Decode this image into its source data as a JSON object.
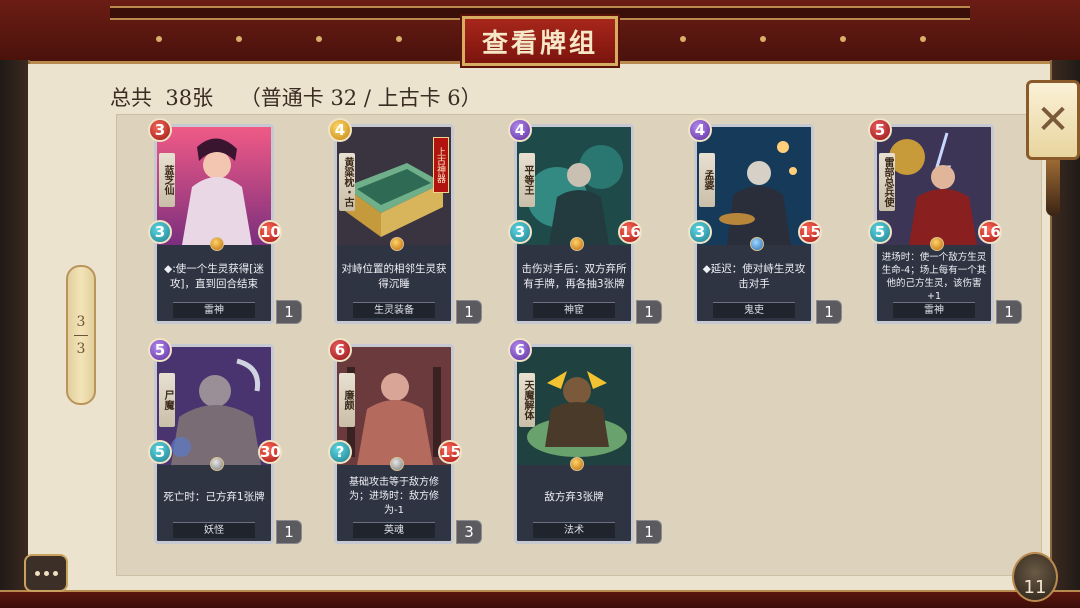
{
  "window": {
    "title": "查看牌组"
  },
  "summary": {
    "text": "总共  38张    （普通卡 32 / 上古卡 6）"
  },
  "pagination": {
    "current": "3",
    "total": "3"
  },
  "footer": {
    "deck_count": "11"
  },
  "cards": [
    {
      "name": "蓝芝仙",
      "cost": "3",
      "attack": "3",
      "health": "10",
      "rule": "◆:使一个生灵获得[迷攻]，直到回合结束",
      "type": "雷神",
      "qty": "1"
    },
    {
      "name": "黄粱枕・古",
      "tag": "上古神器",
      "cost": "4",
      "attack": "",
      "health": "",
      "rule": "对峙位置的相邻生灵获得沉睡",
      "type": "生灵装备",
      "qty": "1"
    },
    {
      "name": "平等王",
      "cost": "4",
      "attack": "3",
      "health": "16",
      "rule": "击伤对手后：双方弃所有手牌，再各抽3张牌",
      "type": "神宦",
      "qty": "1"
    },
    {
      "name": "孟婆",
      "cost": "4",
      "attack": "3",
      "health": "15",
      "rule": "◆延迟：使对峙生灵攻击对手",
      "type": "鬼吏",
      "qty": "1"
    },
    {
      "name": "雷部总兵使",
      "cost": "5",
      "attack": "5",
      "health": "16",
      "rule": "进场时：使一个敌方生灵生命-4；场上每有一个其他的己方生灵，该伤害+1",
      "type": "雷神",
      "qty": "1"
    },
    {
      "name": "尸魔",
      "cost": "5",
      "attack": "5",
      "health": "30",
      "rule": "死亡时：己方弃1张牌",
      "type": "妖怪",
      "qty": "1"
    },
    {
      "name": "廉颇",
      "cost": "6",
      "attack": "?",
      "health": "15",
      "rule": "基础攻击等于敌方修为；进场时：敌方修为-1",
      "type": "英魂",
      "qty": "3"
    },
    {
      "name": "天魔解体",
      "cost": "6",
      "attack": "",
      "health": "",
      "rule": "敌方弃3张牌",
      "type": "法术",
      "qty": "1"
    }
  ]
}
